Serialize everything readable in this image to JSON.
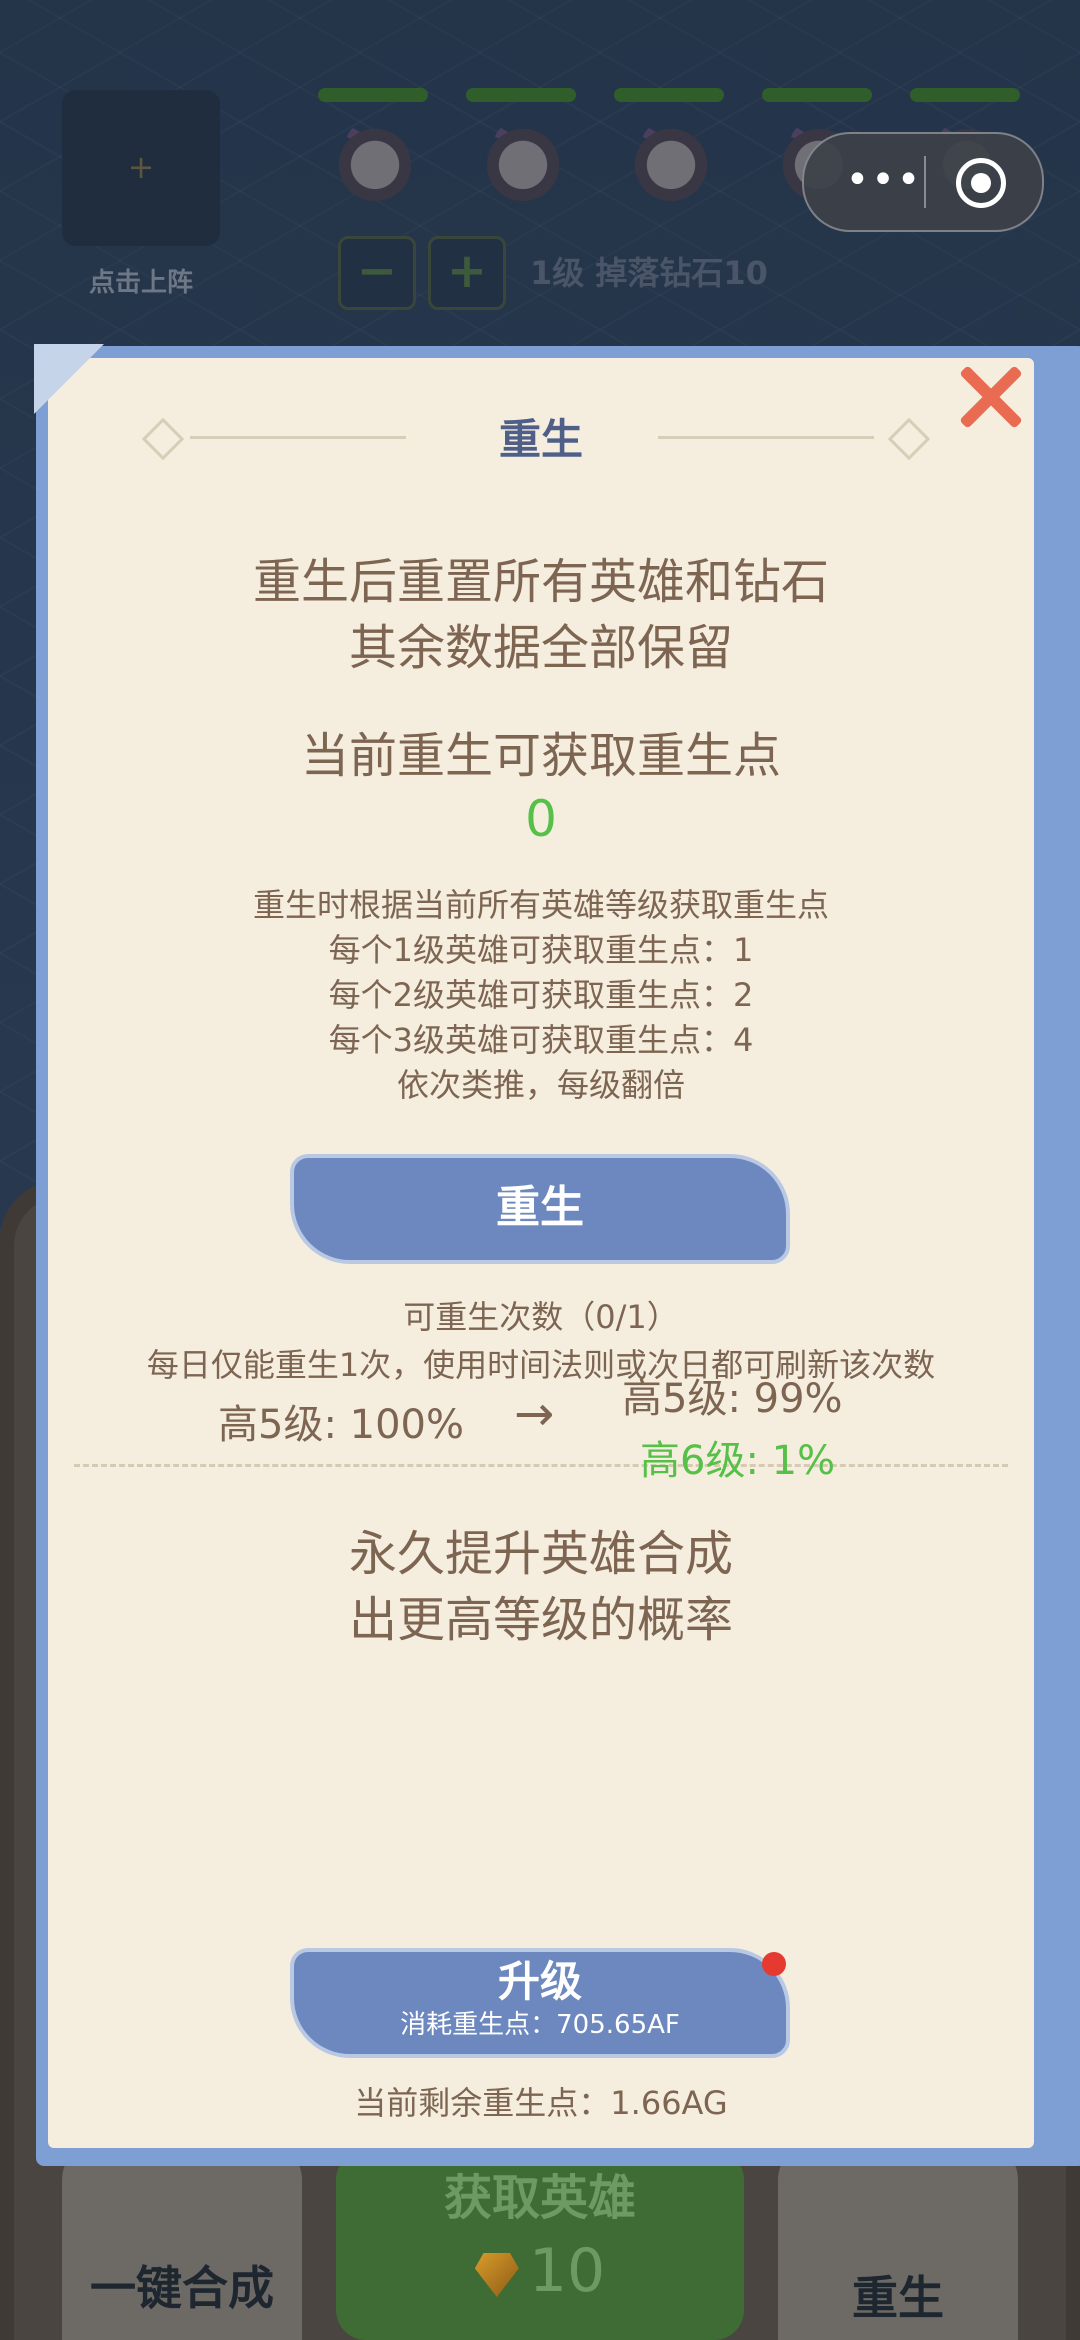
{
  "game": {
    "slot_plus": "+",
    "slot_label": "点击上阵",
    "minus_label": "−",
    "plus_label": "+",
    "level_drop_text": "1级 掉落钻石10",
    "bottom": {
      "merge_label": "一键合成",
      "get_hero_label": "获取英雄",
      "get_hero_cost": "10",
      "rebirth_label": "重生"
    }
  },
  "capsule": {
    "more": "•••"
  },
  "modal": {
    "title": "重生",
    "intro_line1": "重生后重置所有英雄和钻石",
    "intro_line2": "其余数据全部保留",
    "points_heading": "当前重生可获取重生点",
    "points_value": "0",
    "rules": [
      "重生时根据当前所有英雄等级获取重生点",
      "每个1级英雄可获取重生点：1",
      "每个2级英雄可获取重生点：2",
      "每个3级英雄可获取重生点：4",
      "依次类推，每级翻倍"
    ],
    "rebirth_button": "重生",
    "rebirth_count": "可重生次数（0/1）",
    "rebirth_note": "每日仅能重生1次，使用时间法则或次日都可刷新该次数",
    "upgrade_heading_line1": "永久提升英雄合成",
    "upgrade_heading_line2": "出更高等级的概率",
    "rate_current": "高5级: 100%",
    "rate_arrow": "→",
    "rate_next_1": "高5级: 99%",
    "rate_next_2": "高6级: 1%",
    "upgrade_button_title": "升级",
    "upgrade_button_cost": "消耗重生点：705.65AF",
    "remaining_points": "当前剩余重生点：1.66AG"
  },
  "colors": {
    "modal_bg": "#f5eedf",
    "frame": "#7d9fd3",
    "button": "#6c88bf",
    "accent_green": "#56c048",
    "close": "#e96c52",
    "text": "#7d6552"
  }
}
